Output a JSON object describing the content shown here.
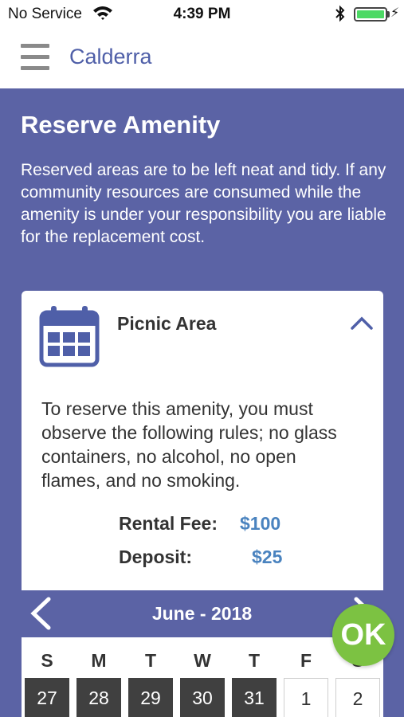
{
  "status_bar": {
    "carrier": "No Service",
    "time": "4:39 PM",
    "bluetooth_icon": "bluetooth-icon",
    "battery_level": 1.0,
    "battery_color": "#4cd964"
  },
  "nav": {
    "title": "Calderra",
    "menu_icon": "hamburger-menu-icon"
  },
  "page": {
    "title": "Reserve Amenity",
    "intro": "Reserved areas are to be left neat and tidy. If any community resources are consumed while the amenity is under your responsibility you are liable for the replacement cost."
  },
  "amenity": {
    "name": "Picnic Area",
    "icon": "calendar-icon",
    "expanded": true,
    "rules": "To reserve this amenity, you must observe the following rules; no glass containers, no alcohol, no open flames, and no smoking.",
    "fee_label": "Rental Fee:",
    "fee_value": "$100",
    "deposit_label": "Deposit:",
    "deposit_value": "$25"
  },
  "calendar": {
    "month_label": "June - 2018",
    "weekdays": [
      "S",
      "M",
      "T",
      "W",
      "T",
      "F",
      "S"
    ],
    "days": [
      {
        "label": "27",
        "state": "past"
      },
      {
        "label": "28",
        "state": "past"
      },
      {
        "label": "29",
        "state": "past"
      },
      {
        "label": "30",
        "state": "past"
      },
      {
        "label": "31",
        "state": "past"
      },
      {
        "label": "1",
        "state": "future"
      },
      {
        "label": "2",
        "state": "future"
      }
    ]
  },
  "ok_button": {
    "label": "OK",
    "color": "#7cc242"
  },
  "colors": {
    "background": "#5b63a5",
    "accent": "#4f5fa8",
    "price": "#4a83bf"
  }
}
